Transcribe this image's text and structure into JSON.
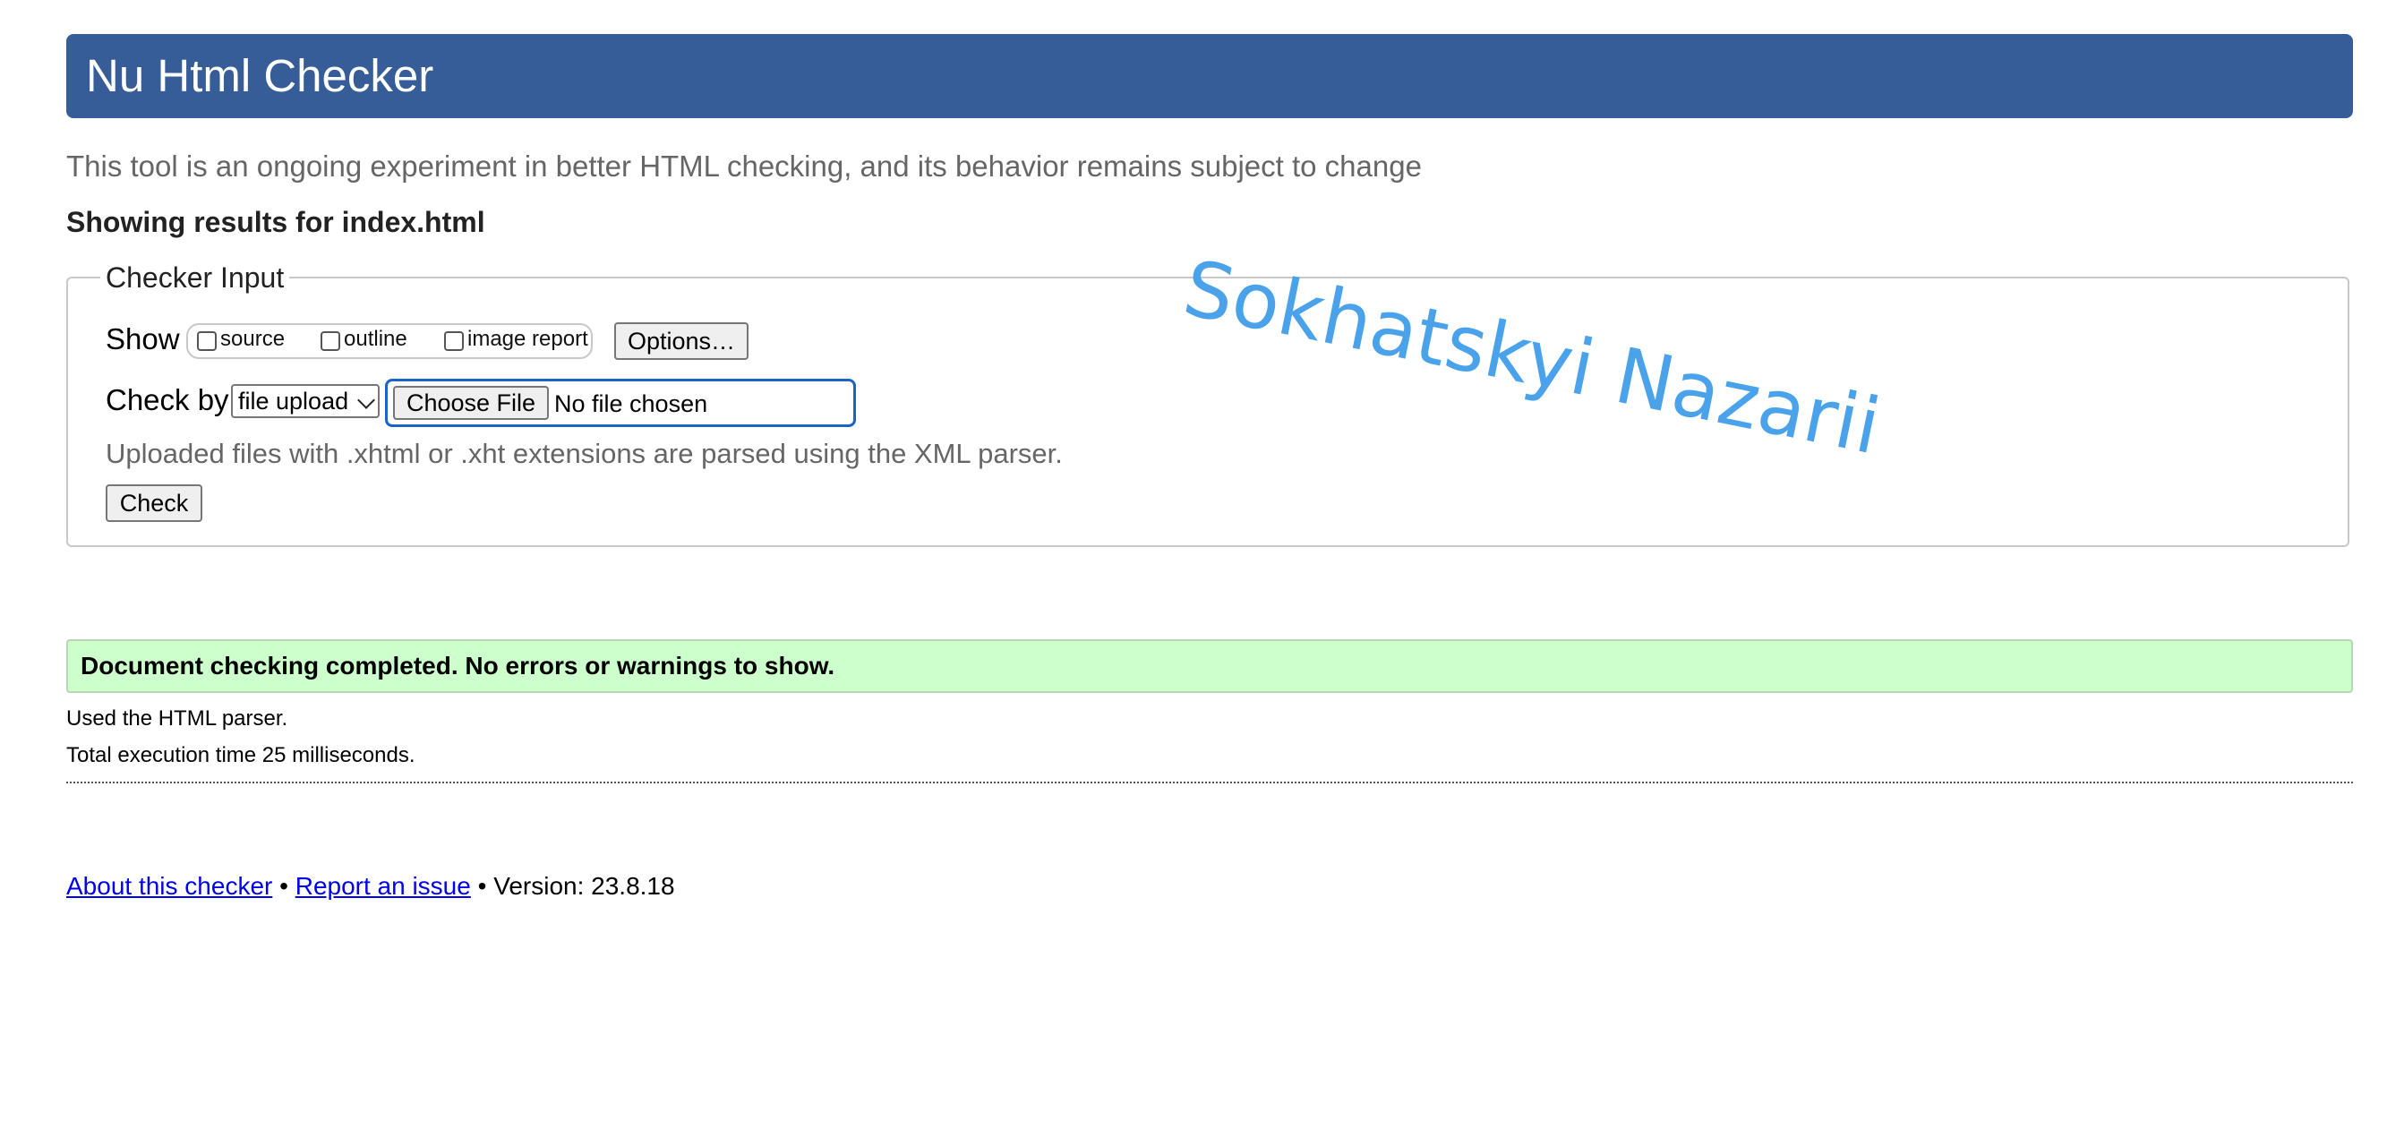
{
  "header": {
    "title": "Nu Html Checker"
  },
  "intro": "This tool is an ongoing experiment in better HTML checking, and its behavior remains subject to change",
  "showing_results": "Showing results for index.html",
  "checker_input": {
    "legend": "Checker Input",
    "show_label": "Show",
    "show_options": [
      {
        "label": "source",
        "checked": false
      },
      {
        "label": "outline",
        "checked": false
      },
      {
        "label": "image report",
        "checked": false
      }
    ],
    "options_button": "Options…",
    "check_by_label": "Check by",
    "check_by_value": "file upload",
    "choose_file_button": "Choose File",
    "file_status": "No file chosen",
    "hint": "Uploaded files with .xhtml or .xht extensions are parsed using the XML parser.",
    "check_button": "Check"
  },
  "result": {
    "message": "Document checking completed. No errors or warnings to show.",
    "parser_note": "Used the HTML parser.",
    "execution_note": "Total execution time 25 milliseconds."
  },
  "footer": {
    "about_link": "About this checker",
    "separator": "•",
    "report_link": "Report an issue",
    "version": "• Version: 23.8.18"
  },
  "watermark": "Sokhatskyi Nazarii",
  "colors": {
    "header_bg": "#365d98",
    "success_bg": "#ccffcc",
    "link": "#0000ee",
    "watermark": "#4aa3ea"
  }
}
